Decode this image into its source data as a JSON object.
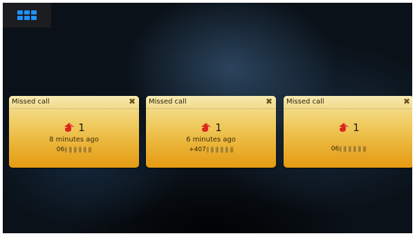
{
  "launcher": {
    "icon": "app-grid-icon"
  },
  "notifications": [
    {
      "title": "Missed call",
      "count": "1",
      "time": "8 minutes ago",
      "number_prefix": "06",
      "close_icon": "close-icon",
      "call_icon": "missed-call-icon"
    },
    {
      "title": "Missed call",
      "count": "1",
      "time": "6 minutes ago",
      "number_prefix": "+407",
      "close_icon": "close-icon",
      "call_icon": "missed-call-icon"
    },
    {
      "title": "Missed call",
      "count": "1",
      "time": "",
      "number_prefix": "06",
      "close_icon": "close-icon",
      "call_icon": "missed-call-icon"
    }
  ],
  "colors": {
    "accent": "#1e90ff",
    "card_top": "#f6e6a2",
    "card_bottom": "#e59a12",
    "icon_red": "#d9261c"
  }
}
